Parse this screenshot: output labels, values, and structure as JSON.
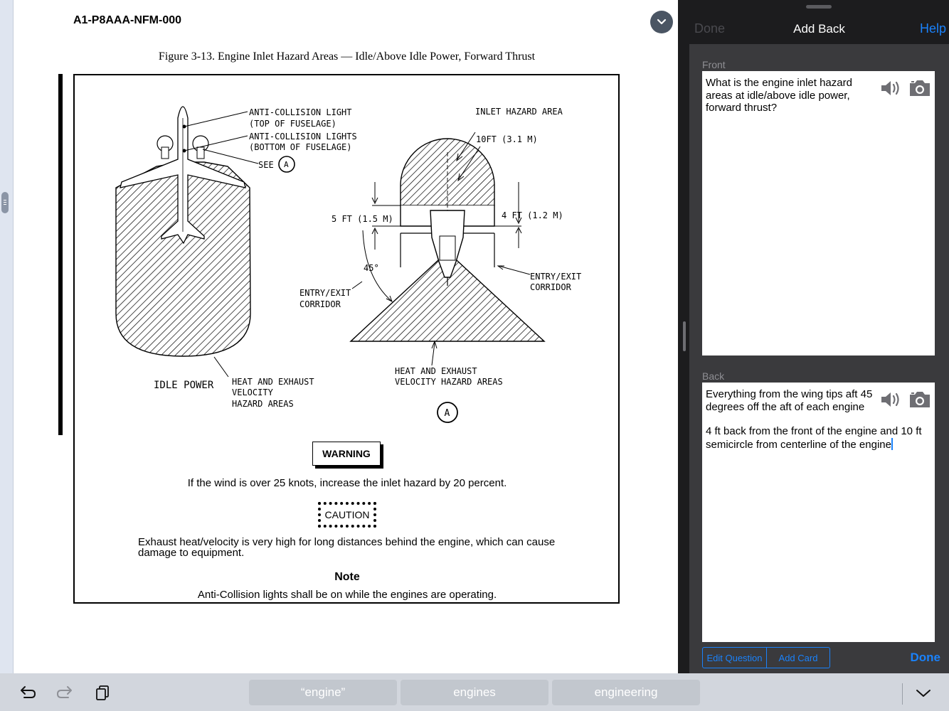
{
  "document": {
    "header": "A1-P8AAA-NFM-000",
    "figure_title": "Figure 3-13. Engine Inlet Hazard Areas — Idle/Above Idle Power, Forward Thrust",
    "labels": {
      "anti_collision_top_1": "ANTI-COLLISION LIGHT",
      "anti_collision_top_2": "(TOP OF FUSELAGE)",
      "anti_collision_bottom_1": "ANTI-COLLISION LIGHTS",
      "anti_collision_bottom_2": "(BOTTOM OF FUSELAGE)",
      "see": "SEE",
      "detail": "A",
      "inlet_hazard_area": "INLET HAZARD AREA",
      "ten_ft": "10FT (3.1 M)",
      "five_ft": "5 FT (1.5 M)",
      "four_ft": "4 FT (1.2 M)",
      "angle": "45°",
      "entry_exit_1": "ENTRY/EXIT",
      "entry_exit_2": "CORRIDOR",
      "idle_power": "IDLE POWER",
      "heat_exhaust_1": "HEAT AND EXHAUST",
      "heat_exhaust_2": "VELOCITY",
      "heat_exhaust_3": "HAZARD AREAS",
      "heat_exhaust_right_1": "HEAT AND EXHAUST",
      "heat_exhaust_right_2": "VELOCITY HAZARD AREAS"
    },
    "warning_label": "WARNING",
    "warning_text": "If the wind is over 25 knots, increase the inlet hazard by 20 percent.",
    "caution_label": "CAUTION",
    "caution_text": "Exhaust heat/velocity is very high for long distances behind the engine, which can cause damage to equipment.",
    "note_label": "Note",
    "note_text": "Anti-Collision lights shall be on while the engines are operating."
  },
  "panel": {
    "done_label": "Done",
    "title": "Add Back",
    "help_label": "Help",
    "front_label": "Front",
    "front_text": "What is the engine inlet hazard areas at idle/above idle power, forward thrust?",
    "back_label": "Back",
    "back_text_1": "Everything from the wing tips aft 45 degrees off the aft of each engine",
    "back_text_2": "4 ft back from the front of the engine and 10 ft semicircle from centerline of the engine",
    "edit_question_label": "Edit Question",
    "add_card_label": "Add Card",
    "bottom_done_label": "Done"
  },
  "keyboard": {
    "suggestions": [
      "“engine”",
      "engines",
      "engineering"
    ]
  },
  "colors": {
    "accent": "#1a82fb",
    "panel_bg": "#3a3a3d",
    "panel_top": "#1c1c1e",
    "keyboard_bg": "#d2d6dd"
  },
  "icons": [
    "undo-icon",
    "redo-icon",
    "clipboard-icon",
    "chevron-down-icon",
    "speaker-icon",
    "camera-icon"
  ]
}
